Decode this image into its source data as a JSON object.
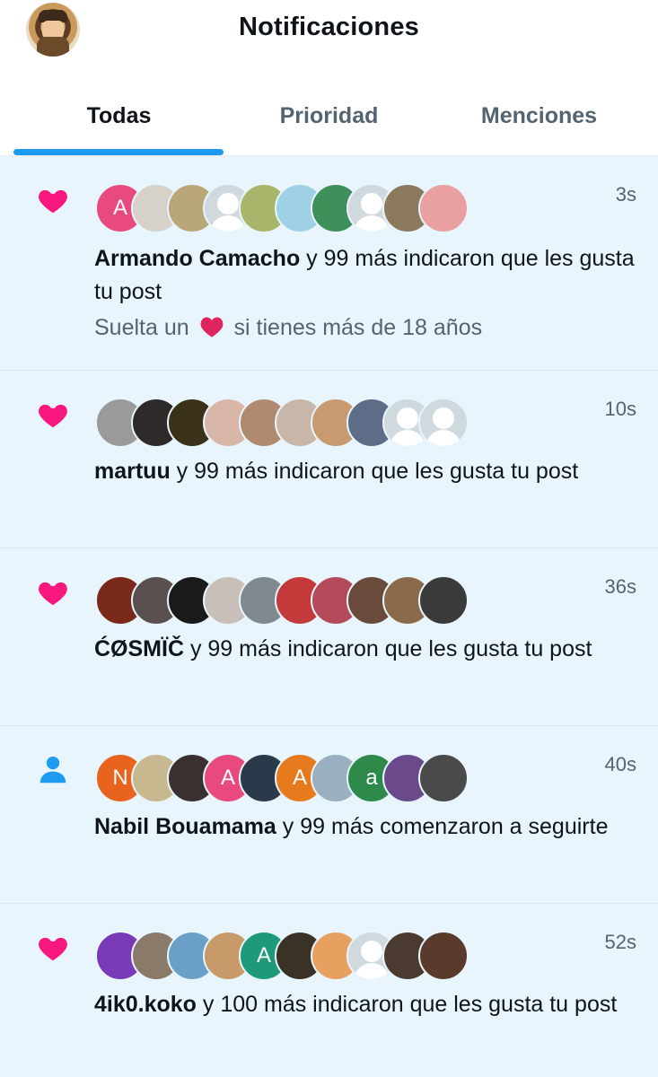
{
  "header": {
    "title": "Notificaciones"
  },
  "tabs": [
    {
      "label": "Todas",
      "active": true
    },
    {
      "label": "Prioridad",
      "active": false
    },
    {
      "label": "Menciones",
      "active": false
    }
  ],
  "colors": {
    "accent": "#1d9bf0",
    "like": "#f91880",
    "follow": "#1d9bf0",
    "background": "#e8f5fd"
  },
  "notifications": [
    {
      "type": "like",
      "icon": "heart-icon",
      "time": "3s",
      "name": "Armando Camacho",
      "rest": " y 99 más indicaron que les gusta tu post",
      "extra_before": "Suelta un",
      "extra_after": "si tienes más de 18 años",
      "avatars": [
        {
          "color": "#e84a7f",
          "letter": "A"
        },
        {
          "color": "#d6d1c9"
        },
        {
          "color": "#b9a77a"
        },
        {
          "color": "#cfd9de",
          "default": true
        },
        {
          "color": "#a7b66a"
        },
        {
          "color": "#9fd0e6"
        },
        {
          "color": "#3e8f5a"
        },
        {
          "color": "#cfd9de",
          "default": true
        },
        {
          "color": "#8c7a5e"
        },
        {
          "color": "#e8a0a0"
        }
      ]
    },
    {
      "type": "like",
      "icon": "heart-icon",
      "time": "10s",
      "name": "martuu",
      "rest": " y 99 más indicaron que les gusta tu post",
      "avatars": [
        {
          "color": "#9a9a9a"
        },
        {
          "color": "#2e2a2a"
        },
        {
          "color": "#3a3218"
        },
        {
          "color": "#d9b7a8"
        },
        {
          "color": "#b08a6e"
        },
        {
          "color": "#c8b6a8"
        },
        {
          "color": "#c89a70"
        },
        {
          "color": "#5d6d88"
        },
        {
          "color": "#cfd9de",
          "default": true
        },
        {
          "color": "#cfd9de",
          "default": true
        }
      ]
    },
    {
      "type": "like",
      "icon": "heart-icon",
      "time": "36s",
      "name": "ĆØSMÏČ",
      "rest": " y 99 más indicaron que les gusta tu post",
      "avatars": [
        {
          "color": "#7a2a1a"
        },
        {
          "color": "#5a5050"
        },
        {
          "color": "#1a1a1a"
        },
        {
          "color": "#c8c0b8"
        },
        {
          "color": "#808890"
        },
        {
          "color": "#c43a3a"
        },
        {
          "color": "#b44a5a"
        },
        {
          "color": "#6a4a3a"
        },
        {
          "color": "#8a6a4a"
        },
        {
          "color": "#3a3a3a"
        }
      ]
    },
    {
      "type": "follow",
      "icon": "person-icon",
      "time": "40s",
      "name": "Nabil Bouamama",
      "rest": " y 99 más comenzaron a seguirte",
      "avatars": [
        {
          "color": "#e8641e",
          "letter": "N"
        },
        {
          "color": "#c8b890"
        },
        {
          "color": "#3a3030"
        },
        {
          "color": "#e84a7f",
          "letter": "A"
        },
        {
          "color": "#2a3a4a"
        },
        {
          "color": "#e87a1e",
          "letter": "A"
        },
        {
          "color": "#9ab0c0"
        },
        {
          "color": "#2e8a4a",
          "letter": "a"
        },
        {
          "color": "#6a4a8a"
        },
        {
          "color": "#4a4a4a"
        }
      ]
    },
    {
      "type": "like",
      "icon": "heart-icon",
      "time": "52s",
      "name": "4ik0.koko",
      "rest": " y 100 más indicaron que les gusta tu post",
      "avatars": [
        {
          "color": "#7a3ab8"
        },
        {
          "color": "#8a7a6a"
        },
        {
          "color": "#6aa0c8"
        },
        {
          "color": "#c89a6a"
        },
        {
          "color": "#1e9a7a",
          "letter": "A"
        },
        {
          "color": "#3a3226"
        },
        {
          "color": "#e8a060"
        },
        {
          "color": "#cfd9de",
          "default": true
        },
        {
          "color": "#4a3a30"
        },
        {
          "color": "#5a3a2a"
        }
      ]
    }
  ]
}
